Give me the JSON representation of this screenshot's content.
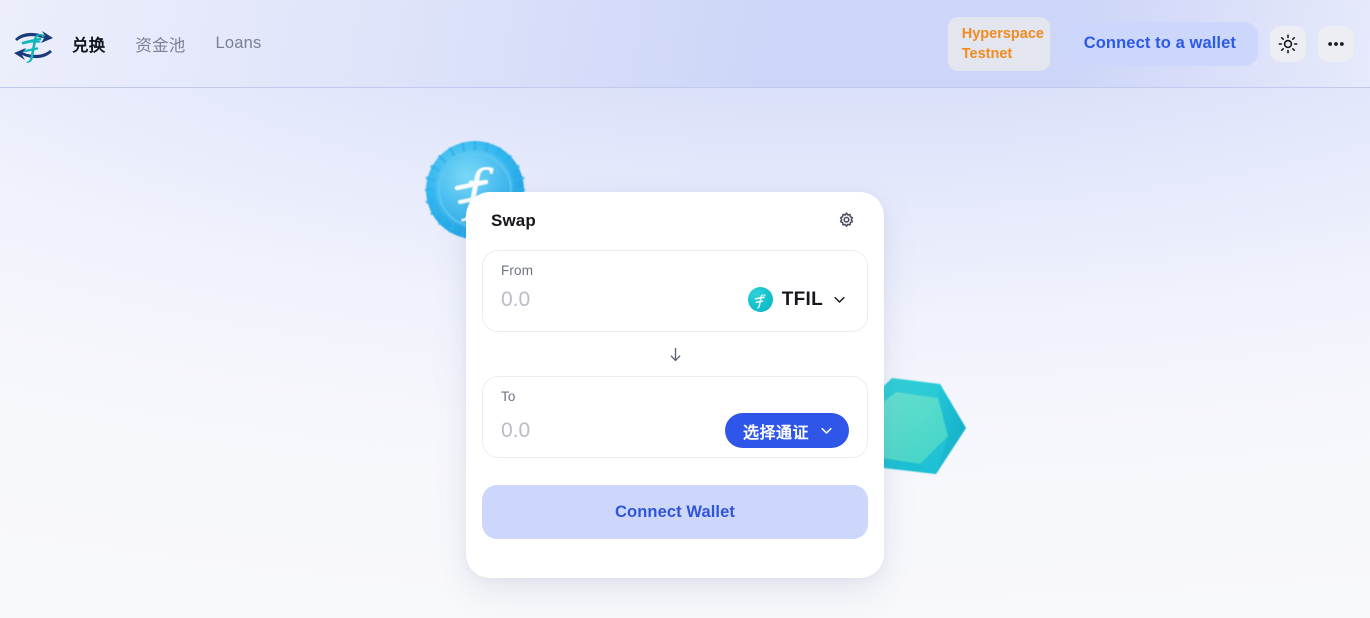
{
  "header": {
    "logo_icon": "filecoin-swap-logo-icon",
    "nav": [
      {
        "label": "兑换",
        "active": true,
        "name": "nav-item-swap"
      },
      {
        "label": "资金池",
        "active": false,
        "name": "nav-item-pool"
      },
      {
        "label": "Loans",
        "active": false,
        "name": "nav-item-loans"
      }
    ],
    "network": {
      "label": "Hyperspace Testnet",
      "line1": "Hyperspace",
      "line2": "Testnet",
      "color": "#f08c20"
    },
    "connect_wallet": {
      "label": "Connect to a wallet",
      "color": "#2b5ae8",
      "background": "#ccd7fb"
    },
    "theme_toggle_icon": "sun-icon",
    "more_menu_icon": "ellipsis-icon"
  },
  "background": {
    "coin_icon": "filecoin-coin-icon",
    "gem_icon": "teal-gem-icon",
    "gradient_from": "#ccd5f9",
    "gradient_to": "#f8f9fb"
  },
  "swap_card": {
    "title": "Swap",
    "settings_icon": "gear-icon",
    "from": {
      "label": "From",
      "amount_value": "",
      "amount_placeholder": "0.0",
      "token_symbol": "TFIL",
      "token_icon": "tfil-token-icon",
      "token_icon_color": "#14c0cc",
      "chevron_icon": "chevron-down-icon"
    },
    "switch_icon": "arrow-down-icon",
    "to": {
      "label": "To",
      "amount_value": "",
      "amount_placeholder": "0.0",
      "select_token_label": "选择通证",
      "select_token_color": "#2f56e8",
      "chevron_icon": "chevron-down-icon"
    },
    "action_button": {
      "label": "Connect Wallet",
      "color": "#2f55d8",
      "background": "#ccd7fb"
    }
  }
}
